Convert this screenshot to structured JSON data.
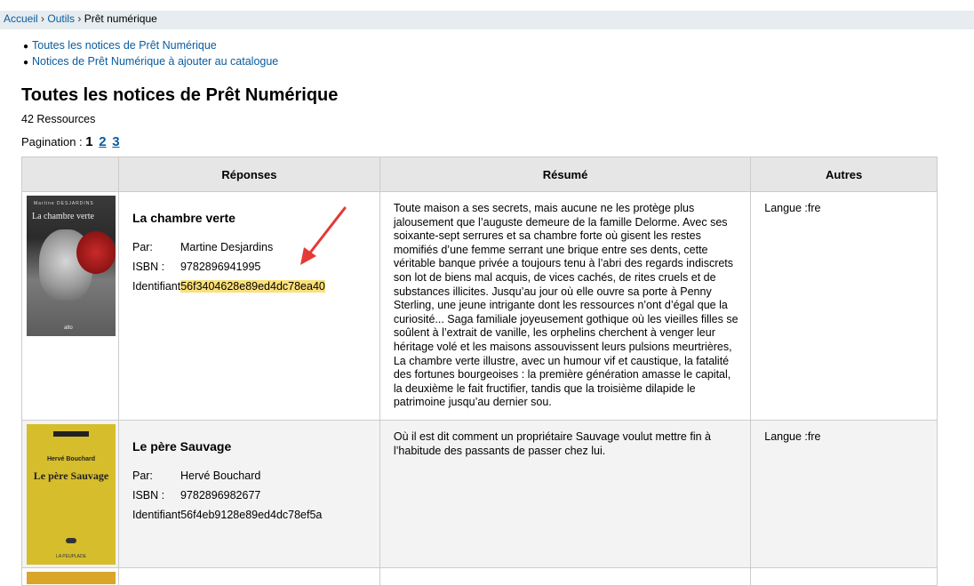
{
  "breadcrumb": {
    "home": "Accueil",
    "tools": "Outils",
    "current": "Prêt numérique",
    "separator": "›"
  },
  "links": [
    "Toutes les notices de Prêt Numérique",
    "Notices de Prêt Numérique à ajouter au catalogue"
  ],
  "page_title": "Toutes les notices de Prêt Numérique",
  "count": "42 Ressources",
  "pagination": {
    "label": "Pagination :",
    "current": "1",
    "pages": [
      "2",
      "3"
    ]
  },
  "table": {
    "headers": [
      "",
      "Réponses",
      "Résumé",
      "Autres"
    ],
    "labels": {
      "by": "Par:",
      "isbn": "ISBN :",
      "id": "Identifiant"
    },
    "rows": [
      {
        "title": "La chambre verte",
        "author": "Martine Desjardins",
        "isbn": "9782896941995",
        "identifier": "56f3404628e89ed4dc78ea40",
        "summary": "Toute maison a ses secrets, mais aucune ne les protège plus jalousement que l’auguste demeure de la famille Delorme. Avec ses soixante-sept serrures et sa chambre forte où gisent les restes momifiés d’une femme serrant une brique entre ses dents, cette véritable banque privée a toujours tenu à l’abri des regards indiscrets son lot de biens mal acquis, de vices cachés, de rites cruels et de substances illicites. Jusqu’au jour où elle ouvre sa porte à Penny Sterling, une jeune intrigante dont les ressources n’ont d’égal que la curiosité... Saga familiale joyeusement gothique où les vieilles filles se soûlent à l’extrait de vanille, les orphelins cherchent à venger leur héritage volé et les maisons assouvissent leurs pulsions meurtrières, La chambre verte illustre, avec un humour vif et caustique, la fatalité des fortunes bourgeoises : la première génération amasse le capital, la deuxième le fait fructifier, tandis que la troisième dilapide le patrimoine jusqu’au dernier sou.",
        "langue": "Langue :fre",
        "cover": {
          "author": "Martine DESJARDINS",
          "title": "La chambre verte",
          "publisher": "alto"
        }
      },
      {
        "title": "Le père Sauvage",
        "author": "Hervé Bouchard",
        "isbn": "9782896982677",
        "identifier": "56f4eb9128e89ed4dc78ef5a",
        "summary": "Où il est dit comment un propriétaire Sauvage voulut mettre fin à l’habitude des passants de passer chez lui.",
        "langue": "Langue :fre",
        "cover": {
          "author": "Hervé Bouchard",
          "title": "Le père Sauvage",
          "publisher": "LA PEUPLADE"
        }
      }
    ]
  },
  "colors": {
    "link": "#0a5ca0",
    "highlight": "#fbe07a",
    "arrow": "#e53935",
    "header_bg": "#e6e6e6",
    "breadcrumb_bg": "#e6ecef"
  }
}
